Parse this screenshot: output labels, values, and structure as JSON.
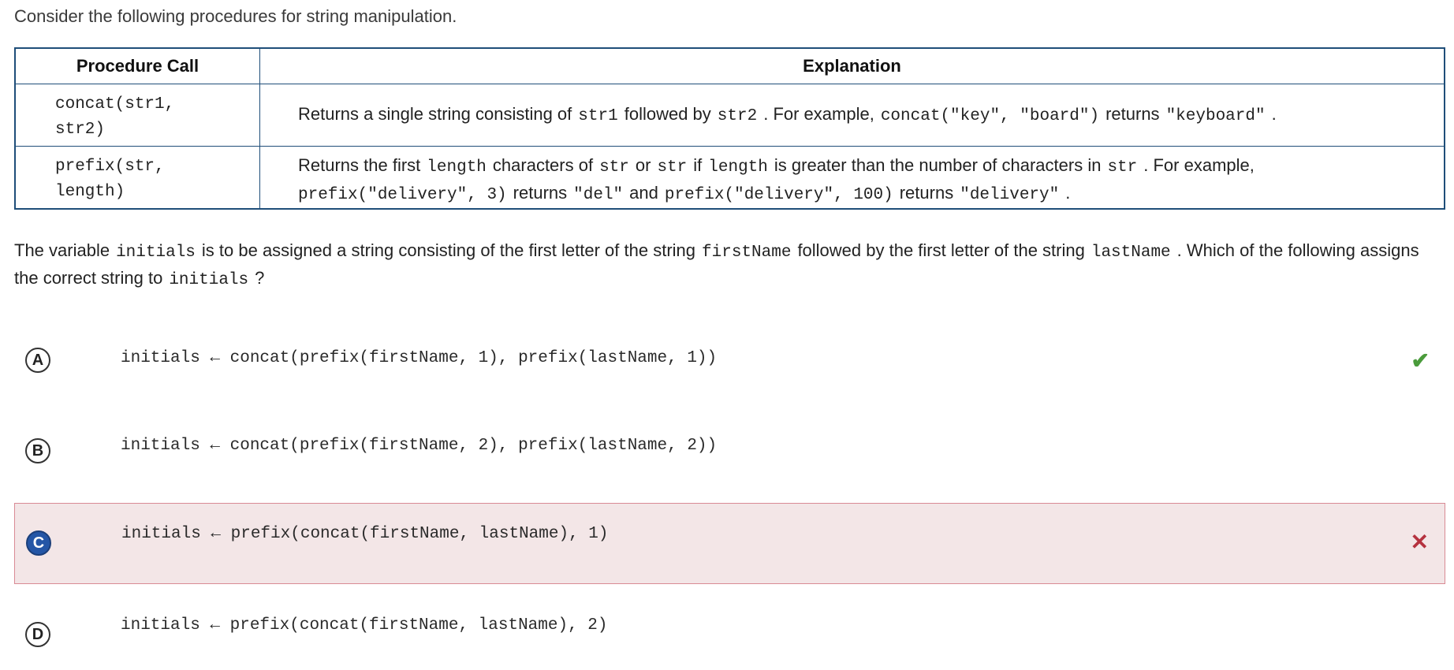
{
  "intro": "Consider the following procedures for string manipulation.",
  "table": {
    "headers": [
      "Procedure Call",
      "Explanation"
    ],
    "rows": [
      {
        "call_line1": "concat(str1,",
        "call_line2": "str2)",
        "explanation": {
          "t1": "Returns a single string consisting of",
          "c1": "str1",
          "t2": "followed by",
          "c2": "str2",
          "t3": ". For example,",
          "c3": "concat(\"key\", \"board\")",
          "t4": "returns",
          "c4": "\"keyboard\"",
          "t5": "."
        }
      },
      {
        "call_line1": "prefix(str,",
        "call_line2": "length)",
        "explanation": {
          "t1": "Returns the first",
          "c1": "length",
          "t2": "characters of",
          "c2": "str",
          "t3": "or",
          "c3": "str",
          "t4": "if",
          "c4": "length",
          "t5": "is greater than the number of characters in",
          "c5": "str",
          "t6": ". For example,",
          "c6": "prefix(\"delivery\", 3)",
          "t7": "returns",
          "c7": "\"del\"",
          "t8": "and",
          "c8": "prefix(\"delivery\", 100)",
          "t9": "returns",
          "c9": "\"delivery\"",
          "t10": "."
        }
      }
    ]
  },
  "question": {
    "t1": "The variable",
    "c1": "initials",
    "t2": "is to be assigned a string consisting of the first letter of the string",
    "c2": "firstName",
    "t3": "followed by the first letter of the string",
    "c3": "lastName",
    "t4": ". Which of the following assigns the correct string to",
    "c4": "initials",
    "t5": "?"
  },
  "options": [
    {
      "letter": "A",
      "code": "initials ← concat(prefix(firstName, 1), prefix(lastName, 1))",
      "state": "correct",
      "icon": "check-icon"
    },
    {
      "letter": "B",
      "code": "initials ← concat(prefix(firstName, 2), prefix(lastName, 2))",
      "state": "none"
    },
    {
      "letter": "C",
      "code": "initials ← prefix(concat(firstName, lastName), 1)",
      "state": "selected-incorrect",
      "icon": "cross-icon"
    },
    {
      "letter": "D",
      "code": "initials ← prefix(concat(firstName, lastName), 2)",
      "state": "none"
    }
  ],
  "colors": {
    "table_border": "#1f4e79",
    "selected_bubble": "#2456a6",
    "wrong_bg": "#f3e6e7",
    "wrong_border": "#d98a94",
    "check": "#4a9b3b",
    "cross": "#b5323f"
  }
}
